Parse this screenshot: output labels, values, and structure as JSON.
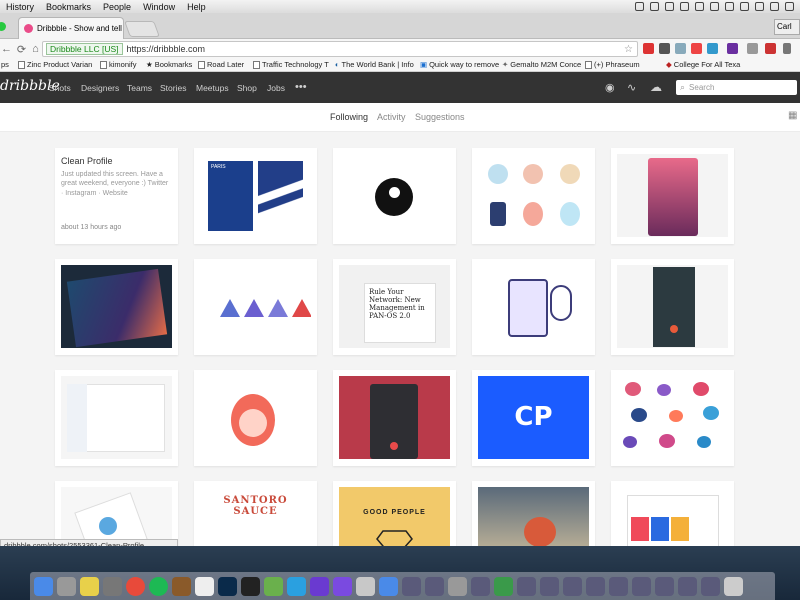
{
  "menubar": {
    "items": [
      "History",
      "Bookmarks",
      "People",
      "Window",
      "Help"
    ]
  },
  "browser": {
    "tab_title": "Dribbble - Show and tell fo",
    "secure_label": "Dribbble LLC [US]",
    "url": "https://dribbble.com",
    "profile_label": "Carl",
    "bookmarks": [
      "ps",
      "Zinc Product Varian",
      "kimonify",
      "Bookmarks",
      "Road Later",
      "Traffic Technology T",
      "The World Bank | Info",
      "Quick way to remove",
      "Gemalto M2M Conce",
      "(+) Phraseum",
      "College For All Texa"
    ]
  },
  "site": {
    "logo": "dribbble",
    "nav": [
      "Shots",
      "Designers",
      "Teams",
      "Stories",
      "Meetups",
      "Shop",
      "Jobs",
      "•••"
    ],
    "search_placeholder": "Search",
    "subnav": [
      "Following",
      "Activity",
      "Suggestions"
    ]
  },
  "first_card": {
    "title": "Clean Profile",
    "description": "Just updated this screen. Have a great weekend, everyone :) Twitter · Instagram · Website",
    "time": "about 13 hours ago"
  },
  "card_texts": {
    "paris": "PARIS",
    "news": "Rule Your Network: New Management in PAN-OS 2.0",
    "sauce_title": "SANTORO SAUCE",
    "good_people": "GOOD PEOPLE",
    "cp": "CP"
  },
  "status_url": "dribbble.com/shots/2553361-Clean-Profile",
  "colors": {
    "dribbble_pink": "#ea4c89",
    "nav_bg": "#333333",
    "blue_card": "#1b5cff"
  }
}
